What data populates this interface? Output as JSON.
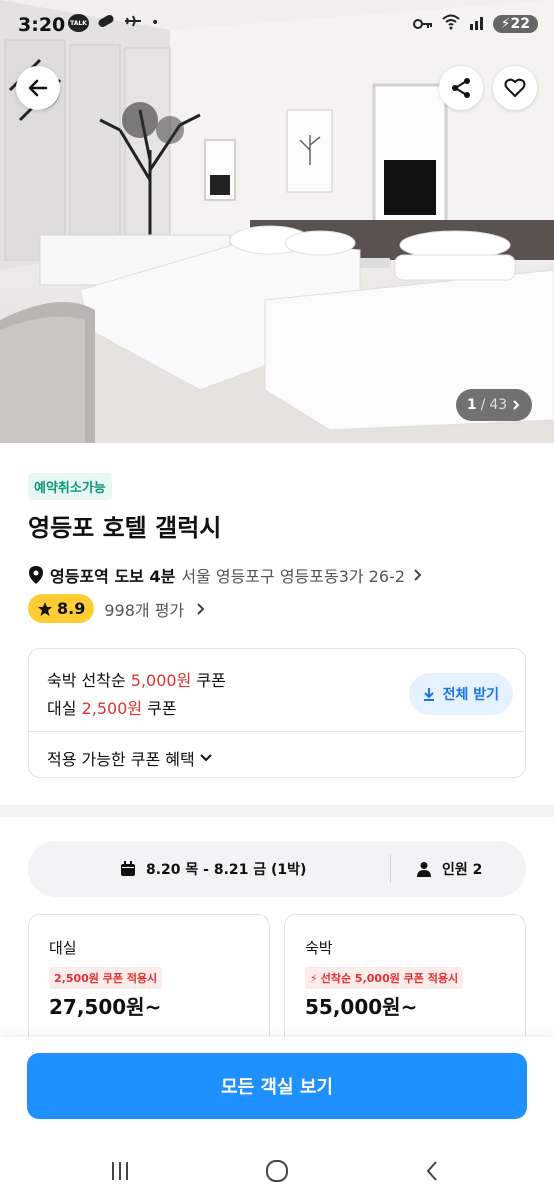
{
  "status_bar": {
    "time": "3:20",
    "talk_label": "TALK",
    "battery": "22"
  },
  "gallery": {
    "current": "1",
    "separator": "/",
    "total": "43"
  },
  "hotel": {
    "cancel_badge": "예약취소가능",
    "name": "영등포 호텔 갤럭시",
    "location_main": "영등포역 도보 4분",
    "address": "서울 영등포구 영등포동3가 26-2",
    "rating": "8.9",
    "review_count": "998개 평가"
  },
  "coupons": {
    "line1_prefix": "숙박 선착순",
    "line1_amount": "5,000원",
    "line1_suffix": "쿠폰",
    "line2_prefix": "대실",
    "line2_amount": "2,500원",
    "line2_suffix": "쿠폰",
    "download_label": "전체 받기",
    "benefits_label": "적용 가능한 쿠폰 혜택"
  },
  "booking": {
    "dates": "8.20 목 - 8.21 금 (1박)",
    "guests": "인원 2"
  },
  "rooms": [
    {
      "type": "대실",
      "tag": "2,500원 쿠폰 적용시",
      "price": "27,500원~"
    },
    {
      "type": "숙박",
      "tag": "선착순 5,000원 쿠폰 적용시",
      "price": "55,000원~"
    }
  ],
  "cta": {
    "label": "모든 객실 보기"
  },
  "colors": {
    "accent": "#1e90ff",
    "price_red": "#e5302f",
    "rating_yellow": "#ffcc33",
    "badge_green": "#0a9a73"
  }
}
